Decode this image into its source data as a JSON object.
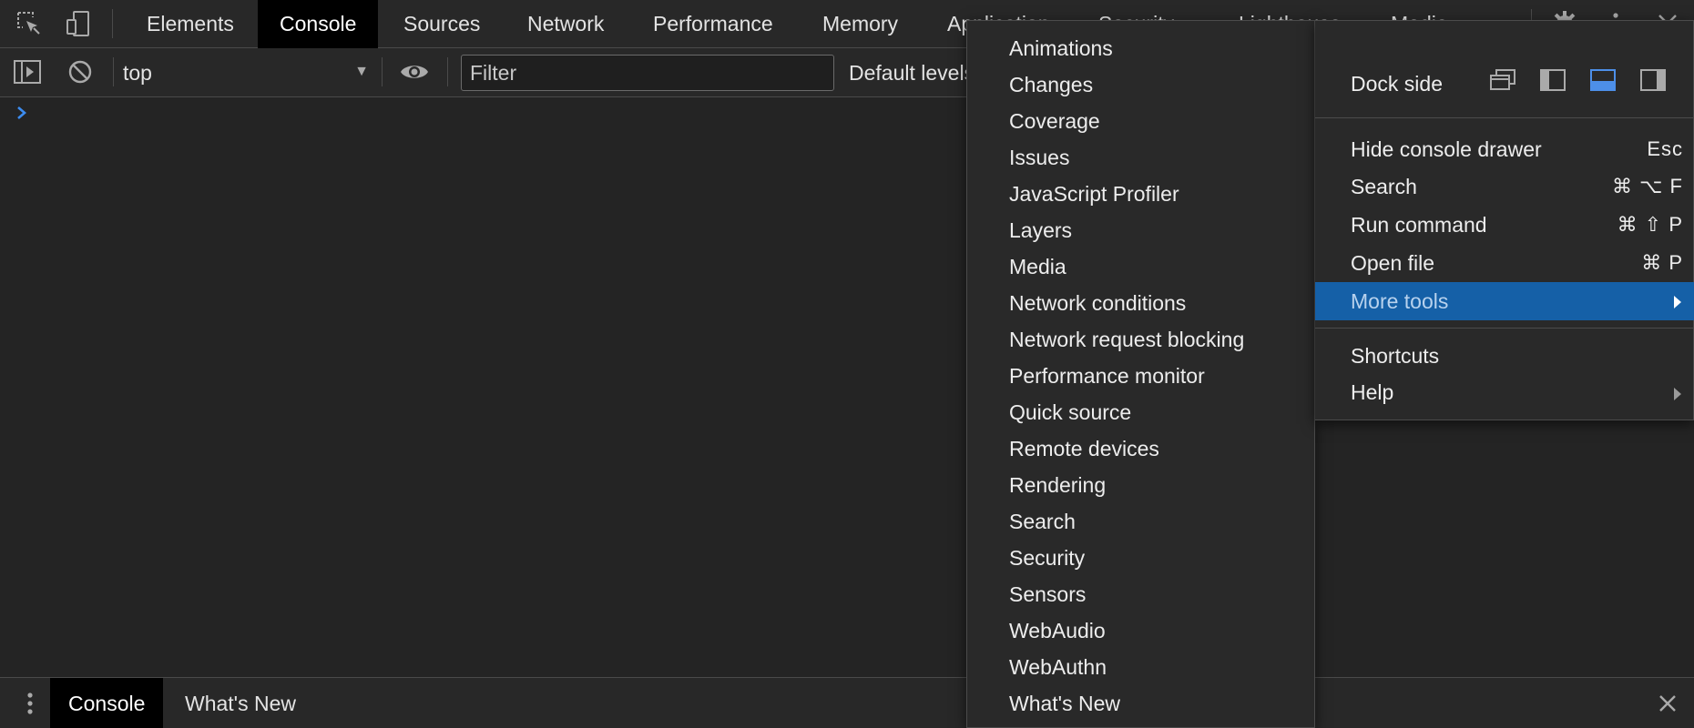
{
  "main_tabs": [
    {
      "label": "Elements",
      "active": false
    },
    {
      "label": "Console",
      "active": true
    },
    {
      "label": "Sources",
      "active": false
    },
    {
      "label": "Network",
      "active": false
    },
    {
      "label": "Performance",
      "active": false
    },
    {
      "label": "Memory",
      "active": false
    },
    {
      "label": "Application",
      "active": false
    },
    {
      "label": "Security",
      "active": false
    },
    {
      "label": "Lighthouse",
      "active": false
    },
    {
      "label": "Media",
      "active": false
    }
  ],
  "toolbar_icons": {
    "inspect": "inspect-element-icon",
    "device": "device-toolbar-icon",
    "settings": "gear-icon",
    "kebab": "vertical-dots-icon",
    "close": "close-icon",
    "sidebar": "show-sidebar-icon",
    "clear": "clear-console-icon",
    "eye": "live-expression-eye-icon"
  },
  "console_toolbar": {
    "context": "top",
    "filter_placeholder": "Filter",
    "levels_label": "Default levels"
  },
  "drawer": {
    "tabs": [
      {
        "label": "Console",
        "active": true
      },
      {
        "label": "What's New",
        "active": false
      }
    ]
  },
  "more_tools_menu": {
    "items": [
      "Animations",
      "Changes",
      "Coverage",
      "Issues",
      "JavaScript Profiler",
      "Layers",
      "Media",
      "Network conditions",
      "Network request blocking",
      "Performance monitor",
      "Quick source",
      "Remote devices",
      "Rendering",
      "Search",
      "Security",
      "Sensors",
      "WebAudio",
      "WebAuthn",
      "What's New"
    ]
  },
  "main_menu": {
    "dock_side_label": "Dock side",
    "dock_options": [
      "undock-icon",
      "dock-left-icon",
      "dock-bottom-icon",
      "dock-right-icon"
    ],
    "dock_selected": "dock-bottom-icon",
    "items": [
      {
        "label": "Hide console drawer",
        "shortcut": "Esc"
      },
      {
        "label": "Search",
        "shortcut": "⌘ ⌥ F"
      },
      {
        "label": "Run command",
        "shortcut": "⌘ ⇧ P"
      },
      {
        "label": "Open file",
        "shortcut": "⌘ P"
      },
      {
        "label": "More tools",
        "shortcut": "",
        "submenu": true,
        "highlighted": true
      }
    ],
    "items2": [
      {
        "label": "Shortcuts"
      },
      {
        "label": "Help",
        "submenu": true
      }
    ]
  },
  "colors": {
    "accent": "#1560a7",
    "active_tab_bg": "#000000",
    "panel_bg": "#242424",
    "toolbar_bg": "#282828",
    "chevron_blue": "#3c8cf0"
  }
}
